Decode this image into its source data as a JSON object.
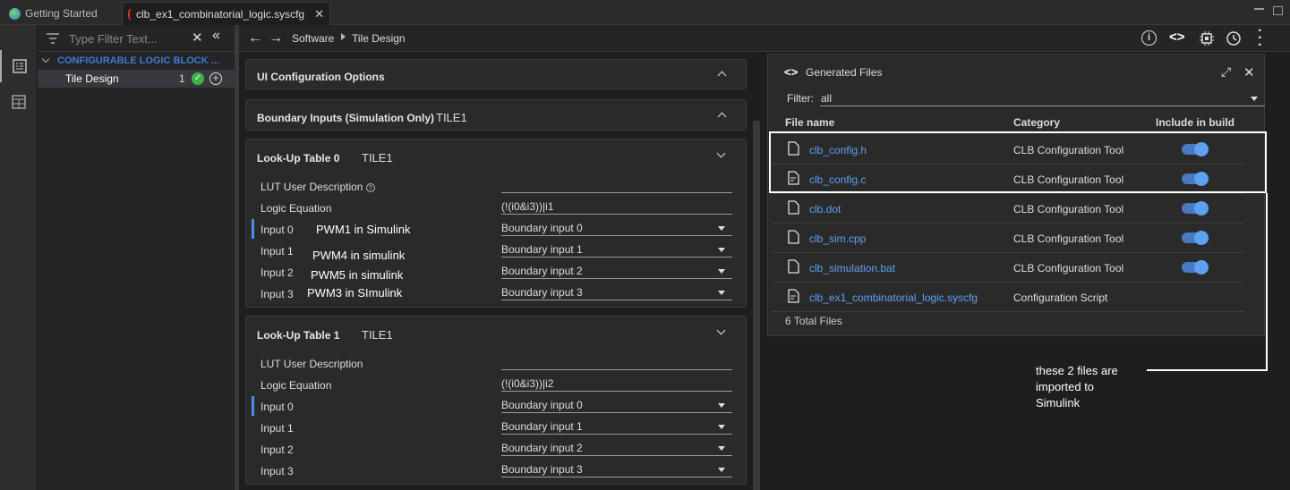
{
  "tabs": [
    {
      "label": "Getting Started"
    },
    {
      "label": "clb_ex1_combinatorial_logic.syscfg"
    }
  ],
  "tree": {
    "filter_placeholder": "Type Filter Text...",
    "group": "CONFIGURABLE LOGIC BLOCK ...",
    "item": {
      "label": "Tile Design",
      "count": "1"
    }
  },
  "breadcrumb": {
    "root": "Software",
    "leaf": "Tile Design"
  },
  "config": {
    "ui_options": "UI Configuration Options",
    "boundary": {
      "title": "Boundary Inputs (Simulation Only)",
      "tile": "TILE1"
    },
    "lut": [
      {
        "title": "Look-Up Table 0",
        "tile": "TILE1",
        "desc_label": "LUT User Description",
        "eq_label": "Logic Equation",
        "equation": "(!(i0&i3))|i1",
        "inputs": [
          {
            "label": "Input 0",
            "value": "Boundary input 0"
          },
          {
            "label": "Input 1",
            "value": "Boundary input 1"
          },
          {
            "label": "Input 2",
            "value": "Boundary input 2"
          },
          {
            "label": "Input 3",
            "value": "Boundary input 3"
          }
        ]
      },
      {
        "title": "Look-Up Table 1",
        "tile": "TILE1",
        "desc_label": "LUT User Description",
        "eq_label": "Logic Equation",
        "equation": "(!(i0&i3))|i2",
        "inputs": [
          {
            "label": "Input 0",
            "value": "Boundary input 0"
          },
          {
            "label": "Input 1",
            "value": "Boundary input 1"
          },
          {
            "label": "Input 2",
            "value": "Boundary input 2"
          },
          {
            "label": "Input 3",
            "value": "Boundary input 3"
          }
        ]
      }
    ],
    "notes": [
      "PWM1 in Simulink",
      "PWM4 in simulink",
      "PWM5 in simulink",
      "PWM3 in SImulink"
    ]
  },
  "generated": {
    "title": "Generated Files",
    "filter_label": "Filter:",
    "filter_value": "all",
    "columns": {
      "name": "File name",
      "category": "Category",
      "include": "Include in build"
    },
    "files": [
      {
        "name": "clb_config.h",
        "category": "CLB Configuration Tool"
      },
      {
        "name": "clb_config.c",
        "category": "CLB Configuration Tool"
      },
      {
        "name": "clb.dot",
        "category": "CLB Configuration Tool"
      },
      {
        "name": "clb_sim.cpp",
        "category": "CLB Configuration Tool"
      },
      {
        "name": "clb_simulation.bat",
        "category": "CLB Configuration Tool"
      },
      {
        "name": "clb_ex1_combinatorial_logic.syscfg",
        "category": "Configuration Script"
      }
    ],
    "total": "6 Total Files"
  },
  "annotation": {
    "lines": [
      "these 2 files are",
      "imported to",
      "Simulink"
    ]
  },
  "colors": {
    "accent": "#5ea1f3",
    "success": "#3fb24b",
    "annotation": "#ffffff"
  }
}
